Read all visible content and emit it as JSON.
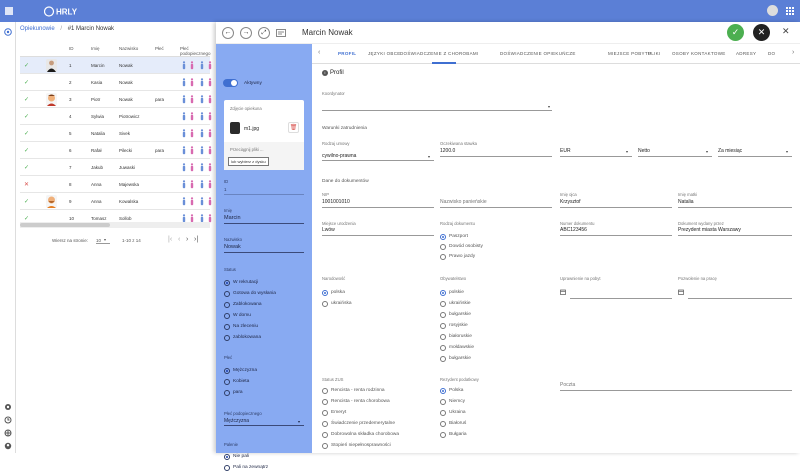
{
  "app": {
    "logo": "HRLY"
  },
  "breadcrumb": {
    "root": "Opiekunowie",
    "sep": "/",
    "current": "#1 Marcin Nowak"
  },
  "table": {
    "headers": [
      "ID",
      "Imię",
      "Nazwisko",
      "Płeć",
      "Płeć podopiecznego"
    ],
    "rows": [
      {
        "status": "ok",
        "id": "1",
        "name": "Marcin",
        "surname": "Nowak",
        "sex": "",
        "photo": "man-dark",
        "sel": true
      },
      {
        "status": "ok",
        "id": "2",
        "name": "Kasia",
        "surname": "Nowak",
        "sex": "",
        "photo": ""
      },
      {
        "status": "ok",
        "id": "3",
        "name": "Piotr",
        "surname": "Nowak",
        "sex": "para",
        "photo": "man-red"
      },
      {
        "status": "ok",
        "id": "4",
        "name": "Sylwia",
        "surname": "Piotrowicz",
        "sex": "",
        "photo": ""
      },
      {
        "status": "ok",
        "id": "5",
        "name": "Natalia",
        "surname": "Sivek",
        "sex": "",
        "photo": ""
      },
      {
        "status": "ok",
        "id": "6",
        "name": "Rafał",
        "surname": "Pilecki",
        "sex": "para",
        "photo": ""
      },
      {
        "status": "ok",
        "id": "7",
        "name": "Jakub",
        "surname": "Juwaski",
        "sex": "",
        "photo": ""
      },
      {
        "status": "x",
        "id": "8",
        "name": "Anna",
        "surname": "Majewska",
        "sex": "",
        "photo": ""
      },
      {
        "status": "ok",
        "id": "9",
        "name": "Anna",
        "surname": "Kowalska",
        "sex": "",
        "photo": "man-beard"
      },
      {
        "status": "ok",
        "id": "10",
        "name": "Tomasz",
        "surname": "Sollob",
        "sex": "",
        "photo": ""
      }
    ],
    "pager": {
      "rows_label": "Wiersz na stronie:",
      "rows_value": "10",
      "range": "1-10 z 14"
    }
  },
  "panel": {
    "title": "Marcin Nowak",
    "active_label": "Aktywny",
    "photo_label": "Zdjęcie opiekuna",
    "file_name": "m1.jpg",
    "drop_label": "Przeciągnij pliki ...",
    "drop_button": "lub wybierz z dysku",
    "id_label": "ID",
    "id_value": "1",
    "first_name_label": "Imię",
    "first_name": "Marcin",
    "last_name_label": "Nazwisko",
    "last_name": "Nowak",
    "status_label": "Status",
    "statuses": [
      "W rekrutacji",
      "Gotowa do wysłania",
      "Zablokowana",
      "W domu",
      "Na zleceniu",
      "zablokowana"
    ],
    "sex_label": "Płeć",
    "sexes": [
      "Mężczyzna",
      "Kobieta",
      "para"
    ],
    "ward_sex_label": "Płeć podopiecznego",
    "ward_sex": "Mężczyzna",
    "smoking_label": "Palenie",
    "smoking": [
      "Nie pali",
      "Pali na zewnątrz"
    ]
  },
  "tabs": [
    "PROFIL",
    "JĘZYKI OBCE",
    "DOŚWIADCZENIE Z CHOROBAMI",
    "DOŚWIADCZENIE OPIEKUŃCZE",
    "MIEJSCE POBYTU",
    "PLIKI",
    "OSOBY KONTAKTOWE",
    "ADRESY",
    "DO"
  ],
  "profile": {
    "header": "Profil",
    "coordinator_label": "Koordynator",
    "conditions_label": "Warunki zatrudnienia",
    "contract_label": "Rodzaj umowy",
    "contract": "cywilno-prawna",
    "rate_label": "Oczekiwana stawka",
    "rate": "1200.0",
    "currency": "EUR",
    "netgross": "Netto",
    "period": "Za miesiąc",
    "docs_label": "Dane do dokumentów",
    "nip_label": "NIP",
    "nip": "1001001010",
    "maiden_label": "Nazwisko panieńskie",
    "father_label": "Imię ojca",
    "father": "Krzysztof",
    "mother_label": "Imię matki",
    "mother": "Natalia",
    "birthplace_label": "Miejsce urodzenia",
    "birthplace": "Lwów",
    "doctype_label": "Rodzaj dokumentu",
    "doctypes": [
      "Paszport",
      "Dowód osobisty",
      "Prawo jazdy"
    ],
    "docnum_label": "Numer dokumentu",
    "docnum": "ABC123456",
    "issuer_label": "Dokument wydany przez",
    "issuer": "Prezydent miasta Warszawy",
    "nationality_label": "Narodowość",
    "nationalities": [
      "polska",
      "ukraińska"
    ],
    "citizenship_label": "Obywatelstwo",
    "citizenships": [
      "polskie",
      "ukraińskie",
      "bułgarskie",
      "rosyjskie",
      "białoruskie",
      "mołdawskie",
      "bułgarskie"
    ],
    "permit_label": "Uprawnienie na pobyt",
    "workpermit_label": "Pozwolenie na pracę",
    "zus_label": "Status ZUS",
    "zus": [
      "Rencista - renta rodzinna",
      "Rencista - renta chorobowa",
      "Emeryt",
      "Świadczenie przedemerytalne",
      "Dobrowolna składka chorobowa",
      "Stopień niepełnosprawności"
    ],
    "tax_label": "Rezydent podatkowy",
    "tax": [
      "Polska",
      "Niemcy",
      "Ukraina",
      "Białoruś",
      "Bułgaria"
    ],
    "post_label": "Poczta"
  },
  "colors": {
    "topbar": "#5b7fd6",
    "blue_panel": "#88aaf2",
    "accent": "#3f6fd1",
    "fab_save": "#4caf50",
    "fab_close": "#222222"
  }
}
